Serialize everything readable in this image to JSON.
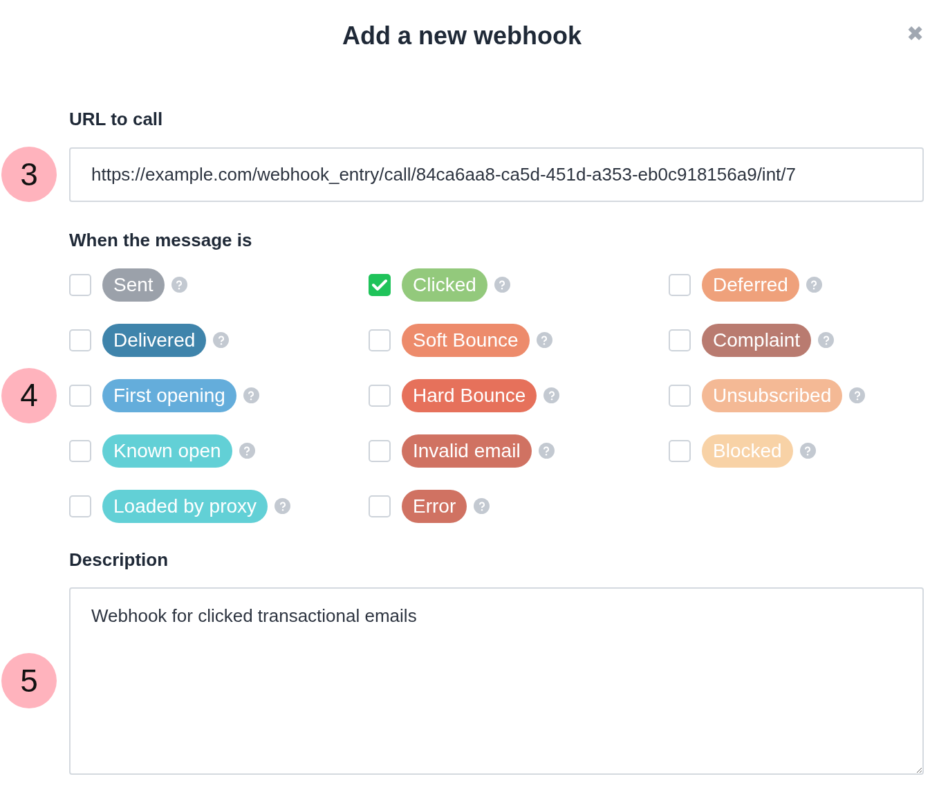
{
  "dialog": {
    "title": "Add a new webhook",
    "close": "✖"
  },
  "steps": [
    "3",
    "4",
    "5"
  ],
  "url": {
    "label": "URL to call",
    "value": "https://example.com/webhook_entry/call/84ca6aa8-ca5d-451d-a353-eb0c918156a9/int/7"
  },
  "events_label": "When the message is",
  "events": [
    {
      "label": "Sent",
      "checked": false,
      "color": "#9ba1aa"
    },
    {
      "label": "Clicked",
      "checked": true,
      "color": "#93c97c"
    },
    {
      "label": "Deferred",
      "checked": false,
      "color": "#efa17b"
    },
    {
      "label": "Delivered",
      "checked": false,
      "color": "#3f84ab"
    },
    {
      "label": "Soft Bounce",
      "checked": false,
      "color": "#ed8b6b"
    },
    {
      "label": "Complaint",
      "checked": false,
      "color": "#b97b70"
    },
    {
      "label": "First opening",
      "checked": false,
      "color": "#64addb"
    },
    {
      "label": "Hard Bounce",
      "checked": false,
      "color": "#e6715b"
    },
    {
      "label": "Unsubscribed",
      "checked": false,
      "color": "#f4b995"
    },
    {
      "label": "Known open",
      "checked": false,
      "color": "#62d0d6"
    },
    {
      "label": "Invalid email",
      "checked": false,
      "color": "#d07262"
    },
    {
      "label": "Blocked",
      "checked": false,
      "color": "#f8d2a6"
    },
    {
      "label": "Loaded by proxy",
      "checked": false,
      "color": "#62d0d6"
    },
    {
      "label": "Error",
      "checked": false,
      "color": "#d07262"
    }
  ],
  "description": {
    "label": "Description",
    "value": "Webhook for clicked transactional emails"
  }
}
